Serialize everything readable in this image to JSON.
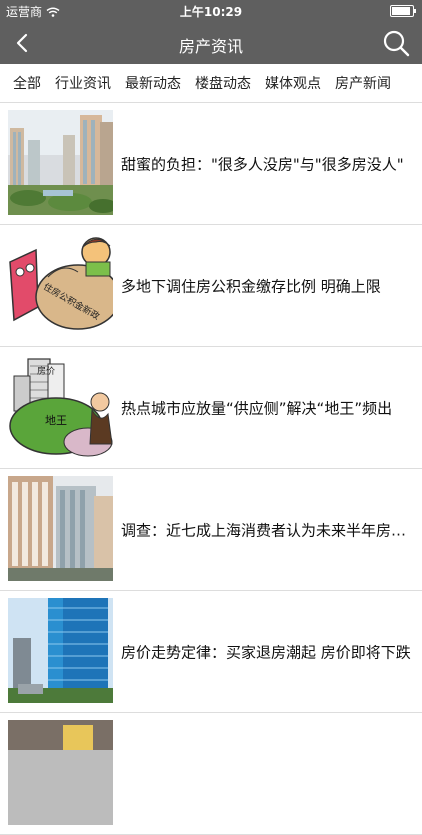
{
  "status": {
    "carrier": "运营商",
    "time": "上午10:29",
    "battery_level": 0.9
  },
  "nav": {
    "title": "房产资讯"
  },
  "tabs": [
    "全部",
    "行业资讯",
    "最新动态",
    "楼盘动态",
    "媒体观点",
    "房产新闻"
  ],
  "articles": [
    {
      "title": "甜蜜的负担：\"很多人没房\"与\"很多房没人\"",
      "image": "city-apartment-blocks"
    },
    {
      "title": "多地下调住房公积金缴存比例 明确上限",
      "image": "housing-fund-cartoon",
      "image_text": "住房公积金新政"
    },
    {
      "title": "热点城市应放量“供应侧”解决“地王”频出",
      "image": "land-king-cartoon",
      "image_text": [
        "房价",
        "地王"
      ]
    },
    {
      "title": "调查：近七成上海消费者认为未来半年房价上涨",
      "image": "residential-towers"
    },
    {
      "title": "房价走势定律：买家退房潮起 房价即将下跌",
      "image": "glass-skyscraper"
    },
    {
      "title": "",
      "image": "building-partial"
    }
  ]
}
